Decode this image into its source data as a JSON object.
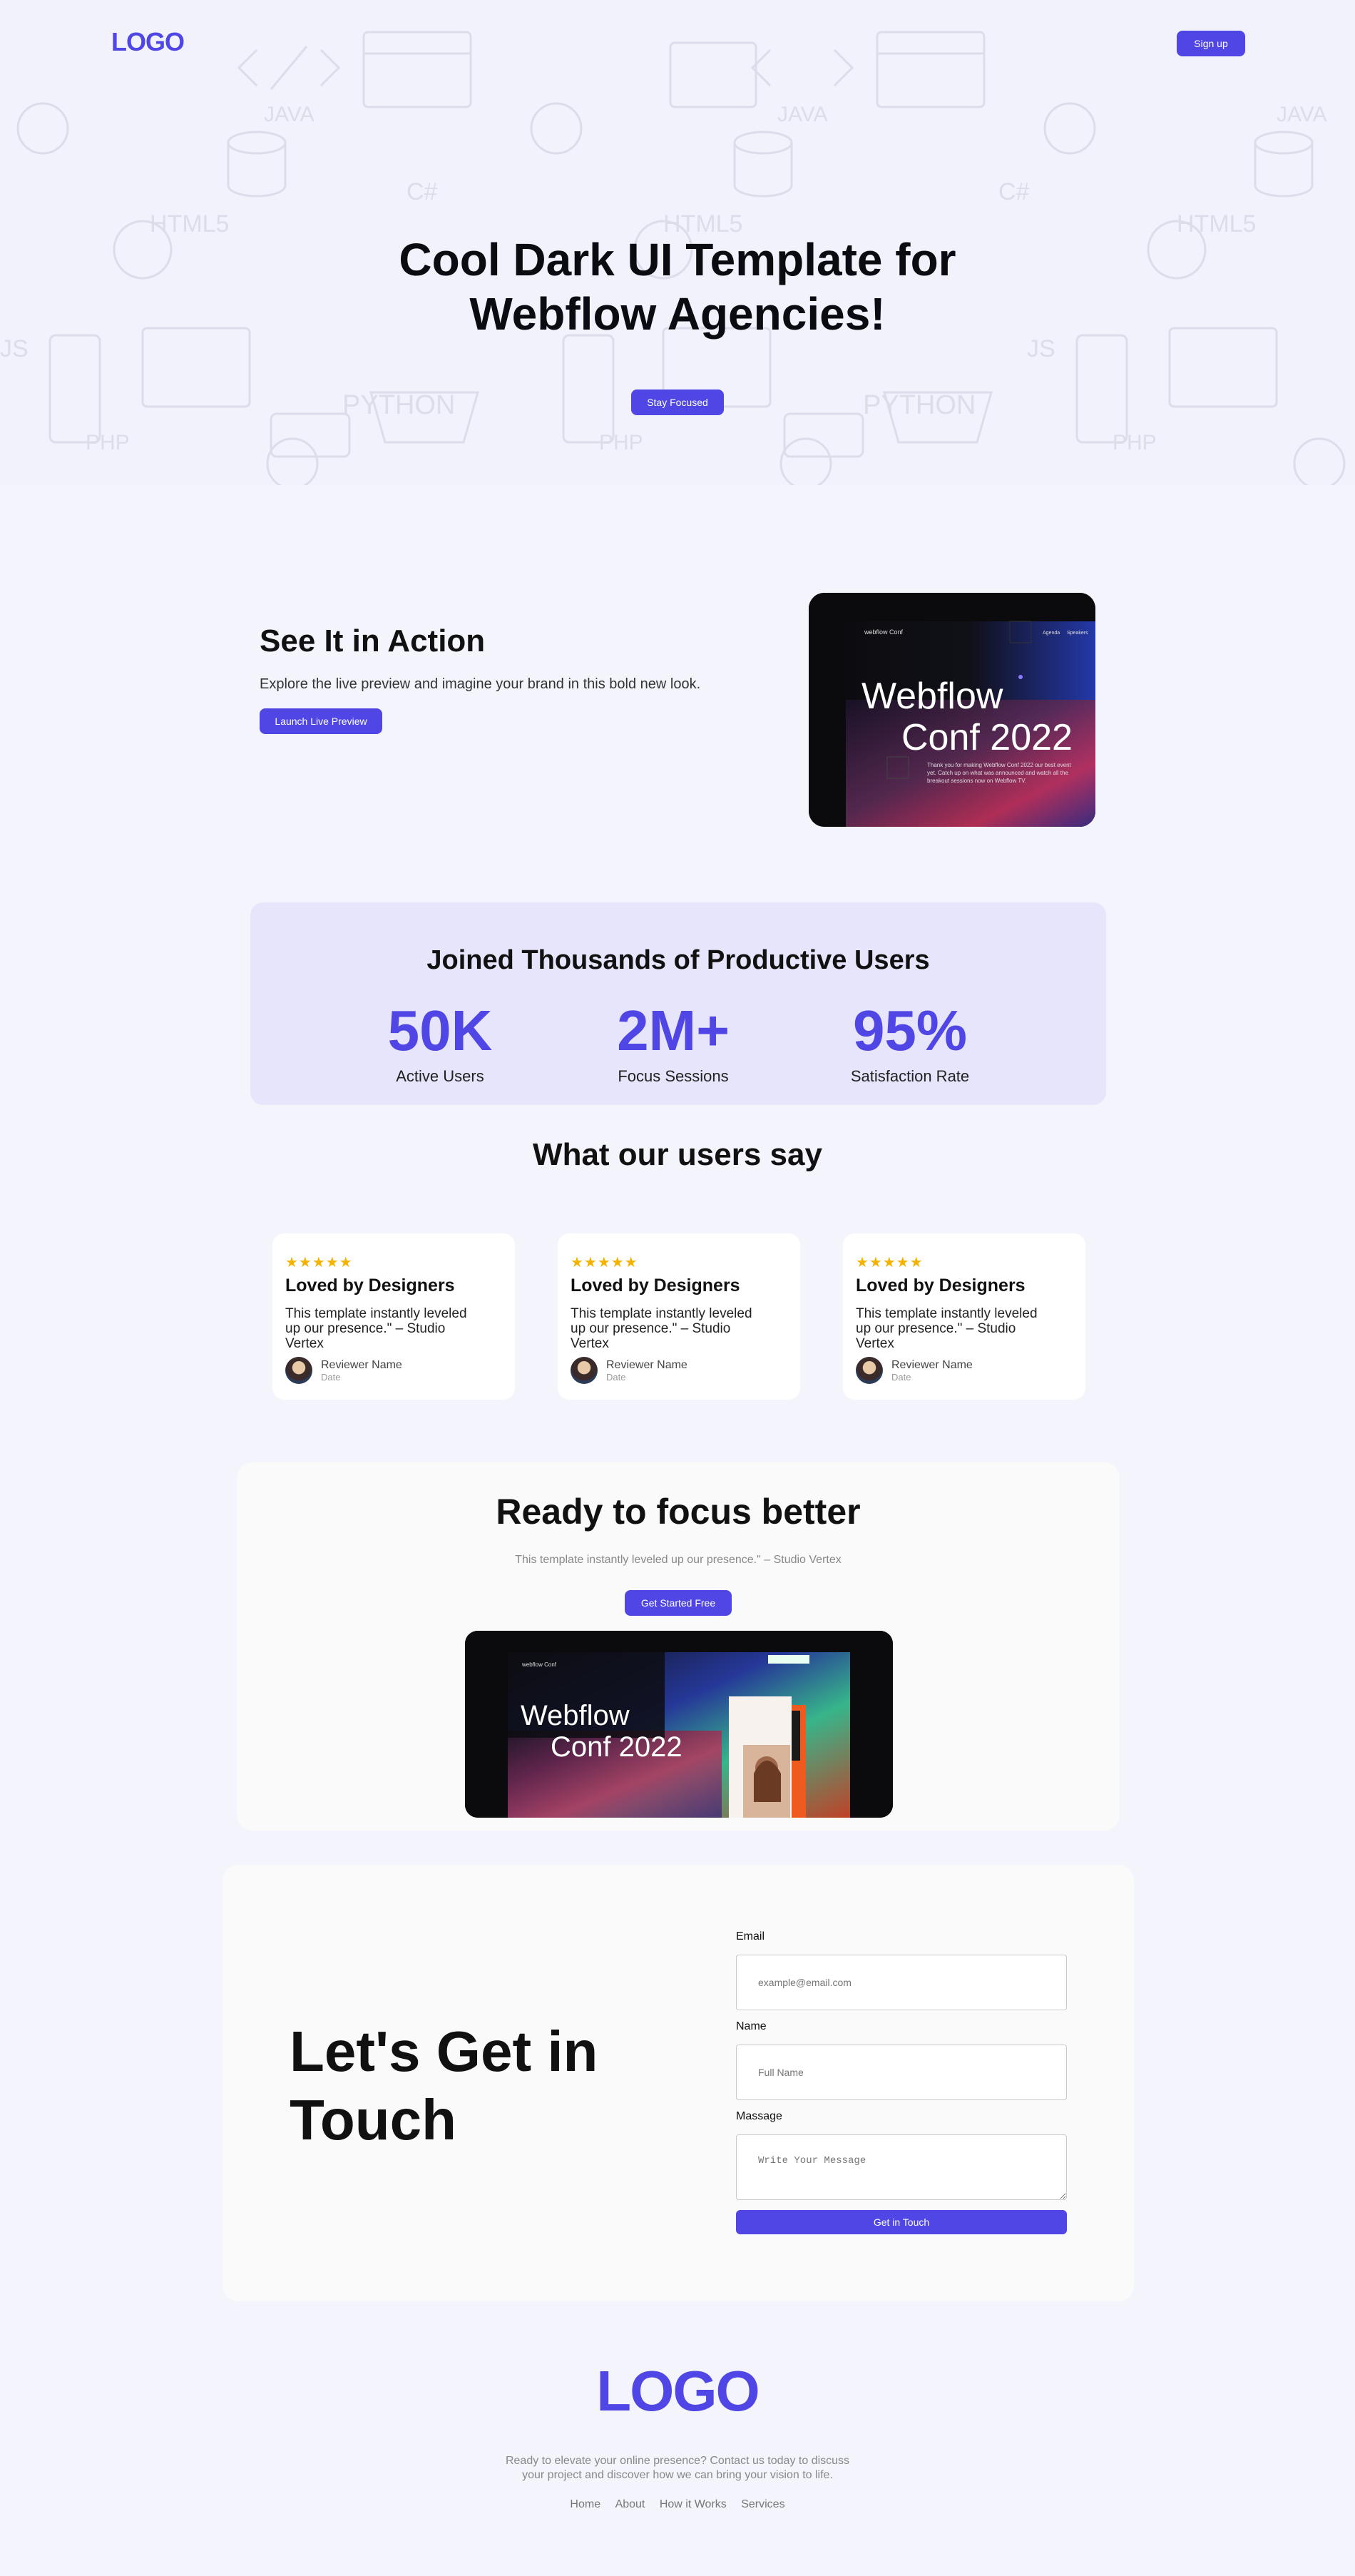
{
  "header": {
    "logo": "LOGO",
    "signup_label": "Sign up"
  },
  "hero": {
    "title": "Cool Dark UI Template for Webflow Agencies!",
    "cta_label": "Stay Focused"
  },
  "action": {
    "title": "See It in Action",
    "subtitle": "Explore the live preview and imagine your brand in this bold new look.",
    "cta_label": "Launch Live Preview",
    "preview": {
      "brand": "webflow Conf",
      "nav": [
        "Agenda",
        "Speakers"
      ],
      "headline_line1": "Webflow",
      "headline_line2": "Conf 2022",
      "blurb": "Thank you for making Webflow Conf 2022 our best event yet. Catch up on what was announced and watch all the breakout sessions now on Webflow TV."
    }
  },
  "stats": {
    "title": "Joined Thousands of Productive Users",
    "items": [
      {
        "value": "50K",
        "label": "Active Users"
      },
      {
        "value": "2M+",
        "label": "Focus Sessions"
      },
      {
        "value": "95%",
        "label": "Satisfaction Rate"
      }
    ]
  },
  "testimonials": {
    "title": "What our users say",
    "items": [
      {
        "stars": "★★★★★",
        "title": "Loved by Designers",
        "text": "This template instantly leveled up our presence.\" – Studio Vertex",
        "name": "Reviewer Name",
        "date": "Date"
      },
      {
        "stars": "★★★★★",
        "title": "Loved by Designers",
        "text": "This template instantly leveled up our presence.\" – Studio Vertex",
        "name": "Reviewer Name",
        "date": "Date"
      },
      {
        "stars": "★★★★★",
        "title": "Loved by Designers",
        "text": "This template instantly leveled up our presence.\" – Studio Vertex",
        "name": "Reviewer Name",
        "date": "Date"
      }
    ]
  },
  "ready": {
    "title": "Ready to focus better",
    "subtitle": "This template instantly leveled up our presence.\" – Studio Vertex",
    "cta_label": "Get Started Free",
    "preview": {
      "brand": "webflow Conf",
      "headline_line1": "Webflow",
      "headline_line2": "Conf 2022"
    }
  },
  "contact": {
    "title": "Let's Get in Touch",
    "email_label": "Email",
    "email_placeholder": "example@email.com",
    "name_label": "Name",
    "name_placeholder": "Full Name",
    "message_label": "Massage",
    "message_placeholder": "Write Your Message",
    "submit_label": "Get in Touch"
  },
  "footer": {
    "logo": "LOGO",
    "text": "Ready to elevate your online presence? Contact us today to discuss your project and discover how we can bring your vision to life.",
    "nav": [
      "Home",
      "About",
      "How it Works",
      "Services"
    ]
  },
  "colors": {
    "accent": "#4f46e5",
    "page_bg": "#f3f4fc",
    "stats_bg": "#e6e5fb",
    "star": "#f5b301"
  }
}
